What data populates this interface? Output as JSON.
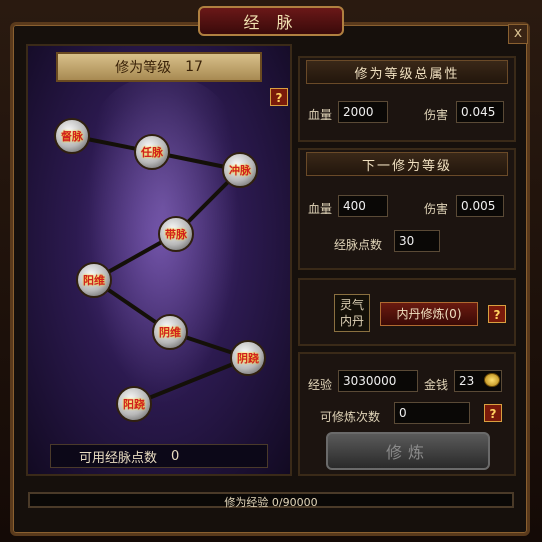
{
  "window": {
    "title": "经 脉",
    "close_label": "x"
  },
  "left": {
    "level_label": "修为等级",
    "level_value": "17",
    "help": "?",
    "nodes": [
      "督脉",
      "任脉",
      "冲脉",
      "带脉",
      "阳维",
      "阴维",
      "阴跷",
      "阳跷"
    ],
    "points_label": "可用经脉点数",
    "points_value": "0"
  },
  "total": {
    "header": "修为等级总属性",
    "hp_label": "血量",
    "hp_value": "2000",
    "dmg_label": "伤害",
    "dmg_value": "0.045"
  },
  "next": {
    "header": "下一修为等级",
    "hp_label": "血量",
    "hp_value": "400",
    "dmg_label": "伤害",
    "dmg_value": "0.005",
    "pts_label": "经脉点数",
    "pts_value": "30"
  },
  "neidan": {
    "lingqi_line1": "灵气",
    "lingqi_line2": "内丹",
    "button": "内丹修炼(0)",
    "help": "?"
  },
  "train": {
    "exp_label": "经验",
    "exp_value": "3030000",
    "gold_label": "金钱",
    "gold_value": "23",
    "times_label": "可修炼次数",
    "times_value": "0",
    "help": "?",
    "button": "修炼"
  },
  "progress": {
    "label": "修为经验",
    "value": "0/90000",
    "fraction": 0.0
  },
  "icons": {
    "close": "close-icon",
    "help": "help-icon",
    "gold": "gold-coin-icon"
  },
  "colors": {
    "accent": "#b08040",
    "node_text": "#d02020"
  }
}
